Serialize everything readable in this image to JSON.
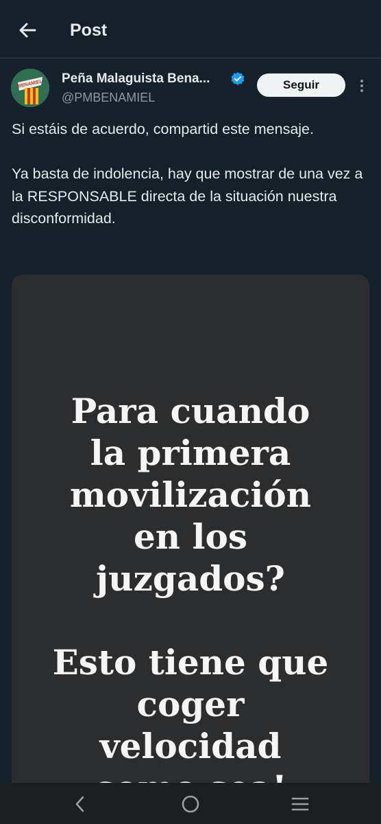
{
  "header": {
    "title": "Post"
  },
  "author": {
    "name": "Peña Malaguista Bena...",
    "handle": "@PMBENAMIEL",
    "follow_label": "Seguir",
    "avatar_text": "BENAMIEL"
  },
  "tweet": {
    "paragraph1": "Si estáis de acuerdo, compartid este mensaje.",
    "paragraph2": "Ya basta de indolencia, hay que mostrar de una vez a la RESPONSABLE directa de la situación nuestra disconformidad."
  },
  "media": {
    "lines1": [
      "Para cuando",
      "la primera",
      "movilización",
      "en los",
      "juzgados?"
    ],
    "lines2": [
      "Esto tiene que",
      "coger",
      "velocidad",
      "como sea!"
    ]
  },
  "colors": {
    "background": "#15202b",
    "verified": "#1d9bf0",
    "media_bg": "#2b2d2f"
  },
  "icons": {
    "back": "arrow-left-icon",
    "verified": "verified-badge-icon",
    "more": "more-vertical-icon",
    "nav_back": "chevron-left-icon",
    "nav_home": "circle-home-icon",
    "nav_recents": "menu-lines-icon"
  }
}
